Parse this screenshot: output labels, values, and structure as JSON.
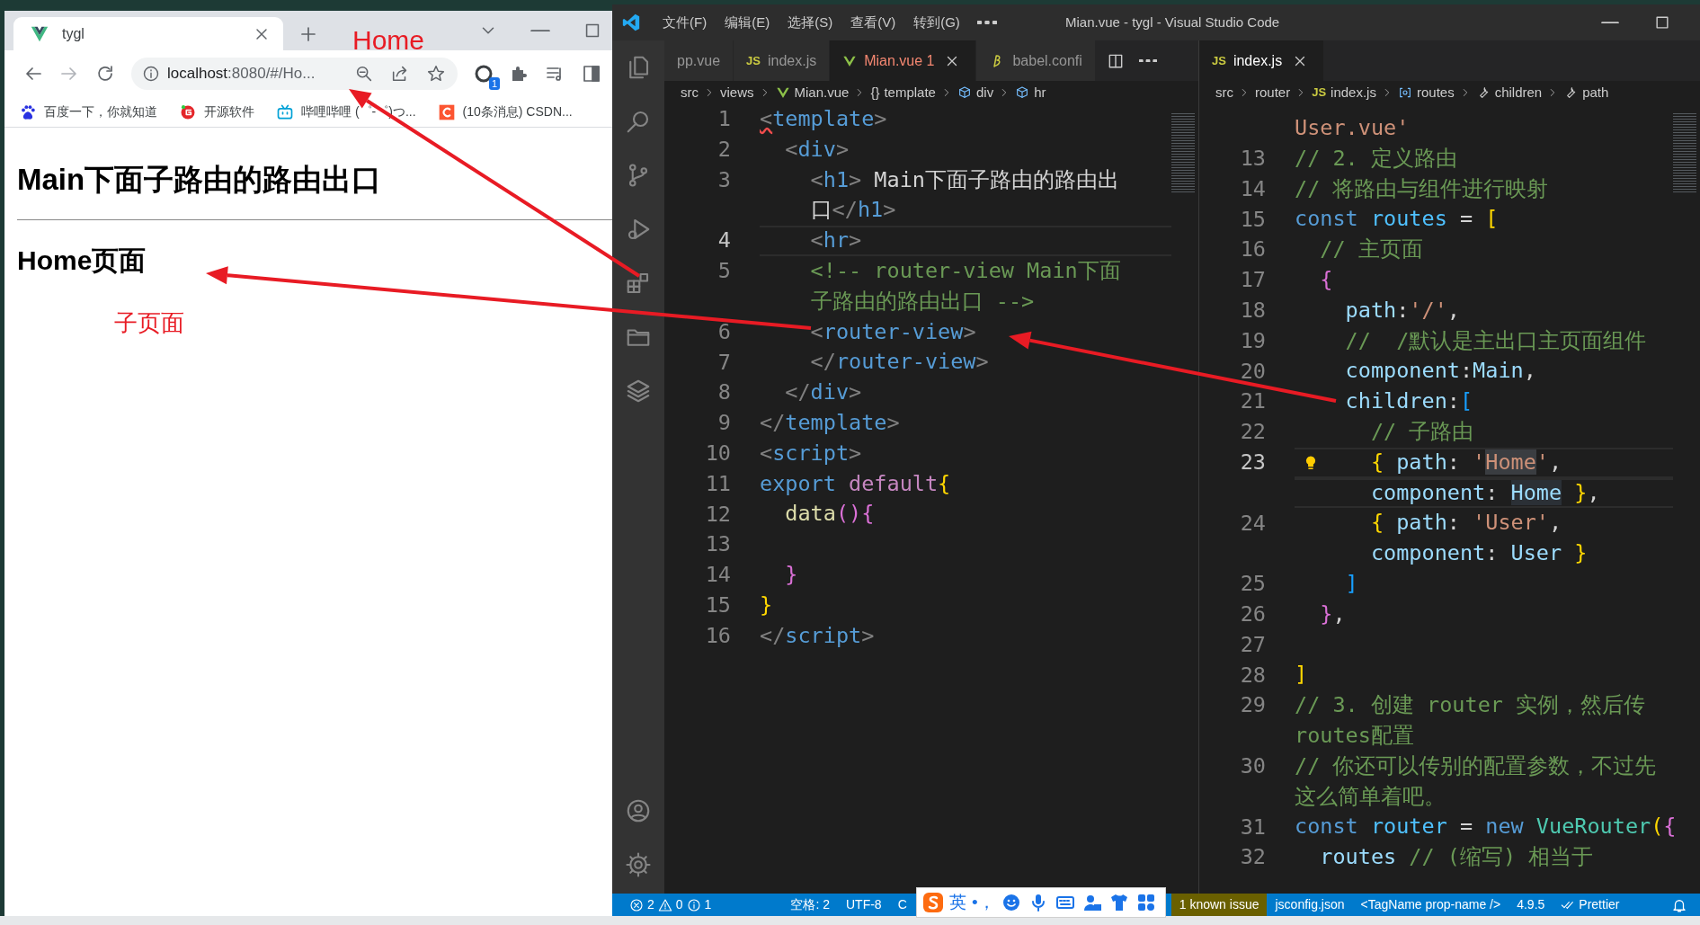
{
  "browser": {
    "tab": {
      "title": "tygl"
    },
    "address": {
      "host": "localhost",
      "path": ":8080/#/Ho..."
    },
    "extension_badge": "1",
    "bookmarks": [
      {
        "label": "百度一下，你就知道",
        "kind": "paw"
      },
      {
        "label": "开源软件",
        "kind": "gitee"
      },
      {
        "label": "哔哩哔哩 (゜-゜)つ...",
        "kind": "tv"
      },
      {
        "label": "(10条消息) CSDN...",
        "kind": "csdn"
      }
    ],
    "page": {
      "heading": "Main下面子路由的路由出口",
      "subheading": "Home页面"
    }
  },
  "annotations": [
    {
      "text": "Home",
      "kind": "tab"
    },
    {
      "text": "子页面",
      "kind": "page"
    }
  ],
  "editor": {
    "title": "Mian.vue - tygl - Visual Studio Code",
    "menus": [
      "文件(F)",
      "编辑(E)",
      "选择(S)",
      "查看(V)",
      "转到(G)"
    ],
    "left_pane": {
      "tabs": [
        {
          "label": "pp.vue",
          "kind": "none",
          "selected": false,
          "has_errors": false
        },
        {
          "label": "index.js",
          "kind": "js",
          "badge": "JS",
          "selected": false,
          "has_errors": false
        },
        {
          "label": "Mian.vue 1",
          "kind": "vue",
          "selected": true,
          "has_errors": true
        },
        {
          "label": "babel.confi",
          "kind": "babel",
          "selected": false,
          "has_errors": false
        }
      ],
      "breadcrumbs": [
        {
          "label": "src",
          "kind": "folder"
        },
        {
          "label": "views",
          "kind": "folder"
        },
        {
          "label": "Mian.vue",
          "kind": "vue"
        },
        {
          "label": "template",
          "kind": "braces",
          "badge": "{}"
        },
        {
          "label": "div",
          "kind": "element"
        },
        {
          "label": "hr",
          "kind": "element"
        }
      ],
      "lines": [
        {
          "number": "1",
          "current": false,
          "rows": [
            {
              "tokens": [
                {
                  "text": "<",
                  "kind": "punct_error"
                },
                {
                  "text": "template",
                  "kind": "tag"
                },
                {
                  "text": ">",
                  "kind": "punct"
                }
              ]
            }
          ]
        },
        {
          "number": "2",
          "current": false,
          "rows": [
            {
              "tokens": [
                {
                  "text": "  <",
                  "kind": "punct"
                },
                {
                  "text": "div",
                  "kind": "tag"
                },
                {
                  "text": ">",
                  "kind": "punct"
                }
              ]
            }
          ]
        },
        {
          "number": "3",
          "current": false,
          "rows": [
            {
              "tokens": [
                {
                  "text": "    <",
                  "kind": "punct"
                },
                {
                  "text": "h1",
                  "kind": "tag"
                },
                {
                  "text": ">",
                  "kind": "punct"
                },
                {
                  "text": " Main下面子路由的路由出",
                  "kind": "text"
                }
              ]
            },
            {
              "tokens": [
                {
                  "text": "    口",
                  "kind": "text"
                },
                {
                  "text": "</",
                  "kind": "punct"
                },
                {
                  "text": "h1",
                  "kind": "tag"
                },
                {
                  "text": ">",
                  "kind": "punct"
                }
              ]
            }
          ]
        },
        {
          "number": "4",
          "current": true,
          "rows": [
            {
              "tokens": [
                {
                  "text": "    <",
                  "kind": "punct"
                },
                {
                  "text": "hr",
                  "kind": "tag"
                },
                {
                  "text": ">",
                  "kind": "punct"
                }
              ]
            }
          ]
        },
        {
          "number": "5",
          "current": false,
          "rows": [
            {
              "tokens": [
                {
                  "text": "    <!-- router-view Main下面",
                  "kind": "comment"
                }
              ]
            },
            {
              "tokens": [
                {
                  "text": "    子路由的路由出口 -->",
                  "kind": "comment"
                }
              ]
            }
          ]
        },
        {
          "number": "6",
          "current": false,
          "rows": [
            {
              "tokens": [
                {
                  "text": "    <",
                  "kind": "punct"
                },
                {
                  "text": "router-view",
                  "kind": "tag"
                },
                {
                  "text": ">",
                  "kind": "punct"
                }
              ]
            }
          ]
        },
        {
          "number": "7",
          "current": false,
          "rows": [
            {
              "tokens": [
                {
                  "text": "    </",
                  "kind": "punct"
                },
                {
                  "text": "router-view",
                  "kind": "tag"
                },
                {
                  "text": ">",
                  "kind": "punct"
                }
              ]
            }
          ]
        },
        {
          "number": "8",
          "current": false,
          "rows": [
            {
              "tokens": [
                {
                  "text": "  </",
                  "kind": "punct"
                },
                {
                  "text": "div",
                  "kind": "tag"
                },
                {
                  "text": ">",
                  "kind": "punct"
                }
              ]
            }
          ]
        },
        {
          "number": "9",
          "current": false,
          "rows": [
            {
              "tokens": [
                {
                  "text": "</",
                  "kind": "punct"
                },
                {
                  "text": "template",
                  "kind": "tag"
                },
                {
                  "text": ">",
                  "kind": "punct"
                }
              ]
            }
          ]
        },
        {
          "number": "10",
          "current": false,
          "rows": [
            {
              "tokens": [
                {
                  "text": "<",
                  "kind": "punct"
                },
                {
                  "text": "script",
                  "kind": "tag"
                },
                {
                  "text": ">",
                  "kind": "punct"
                }
              ]
            }
          ]
        },
        {
          "number": "11",
          "current": false,
          "rows": [
            {
              "tokens": [
                {
                  "text": "export",
                  "kind": "keyword"
                },
                {
                  "text": " default",
                  "kind": "control"
                },
                {
                  "text": "{",
                  "kind": "bracket1"
                }
              ]
            }
          ]
        },
        {
          "number": "12",
          "current": false,
          "rows": [
            {
              "tokens": [
                {
                  "text": "  data",
                  "kind": "func"
                },
                {
                  "text": "(){",
                  "kind": "bracket2"
                }
              ]
            }
          ]
        },
        {
          "number": "13",
          "current": false
        },
        {
          "number": "14",
          "current": false,
          "rows": [
            {
              "tokens": [
                {
                  "text": "  }",
                  "kind": "bracket2"
                }
              ]
            }
          ]
        },
        {
          "number": "15",
          "current": false,
          "rows": [
            {
              "tokens": [
                {
                  "text": "}",
                  "kind": "bracket1"
                }
              ]
            }
          ]
        },
        {
          "number": "16",
          "current": false,
          "rows": [
            {
              "tokens": [
                {
                  "text": "</",
                  "kind": "punct"
                },
                {
                  "text": "script",
                  "kind": "tag"
                },
                {
                  "text": ">",
                  "kind": "punct"
                }
              ]
            }
          ]
        }
      ]
    },
    "right_pane": {
      "tabs": [
        {
          "label": "index.js",
          "kind": "js",
          "badge": "JS",
          "selected": true,
          "has_errors": false
        }
      ],
      "breadcrumbs": [
        {
          "label": "src",
          "kind": "folder"
        },
        {
          "label": "router",
          "kind": "folder"
        },
        {
          "label": "index.js",
          "kind": "js",
          "badge": "JS"
        },
        {
          "label": "routes",
          "kind": "array"
        },
        {
          "label": "children",
          "kind": "property"
        },
        {
          "label": "path",
          "kind": "property"
        }
      ],
      "lines": [
        {
          "current": false,
          "rows": [
            {
              "tokens": [
                {
                  "text": "User.vue'",
                  "kind": "string"
                }
              ]
            }
          ]
        },
        {
          "number": "13",
          "current": false,
          "rows": [
            {
              "tokens": [
                {
                  "text": "// 2. 定义路由",
                  "kind": "comment"
                }
              ]
            }
          ]
        },
        {
          "number": "14",
          "current": false,
          "rows": [
            {
              "tokens": [
                {
                  "text": "// 将路由与组件进行映射",
                  "kind": "comment"
                }
              ]
            }
          ]
        },
        {
          "number": "15",
          "current": false,
          "rows": [
            {
              "tokens": [
                {
                  "text": "const",
                  "kind": "keyword"
                },
                {
                  "text": " routes",
                  "kind": "const"
                },
                {
                  "text": " = ",
                  "kind": "plain"
                },
                {
                  "text": "[",
                  "kind": "bracket1"
                }
              ]
            }
          ]
        },
        {
          "number": "16",
          "current": false,
          "rows": [
            {
              "tokens": [
                {
                  "text": "  // 主页面",
                  "kind": "comment"
                }
              ]
            }
          ]
        },
        {
          "number": "17",
          "current": false,
          "rows": [
            {
              "tokens": [
                {
                  "text": "  {",
                  "kind": "bracket2"
                }
              ]
            }
          ]
        },
        {
          "number": "18",
          "current": false,
          "rows": [
            {
              "tokens": [
                {
                  "text": "    path",
                  "kind": "prop"
                },
                {
                  "text": ":",
                  "kind": "plain"
                },
                {
                  "text": "'/'",
                  "kind": "string"
                },
                {
                  "text": ",",
                  "kind": "plain"
                }
              ]
            }
          ]
        },
        {
          "number": "19",
          "current": false,
          "rows": [
            {
              "tokens": [
                {
                  "text": "    //  /默认是主出口主页面组件",
                  "kind": "comment"
                }
              ]
            }
          ]
        },
        {
          "number": "20",
          "current": false,
          "rows": [
            {
              "tokens": [
                {
                  "text": "    component",
                  "kind": "prop"
                },
                {
                  "text": ":",
                  "kind": "plain"
                },
                {
                  "text": "Main",
                  "kind": "var"
                },
                {
                  "text": ",",
                  "kind": "plain"
                }
              ]
            }
          ]
        },
        {
          "number": "21",
          "current": false,
          "rows": [
            {
              "tokens": [
                {
                  "text": "    children",
                  "kind": "prop"
                },
                {
                  "text": ":",
                  "kind": "plain"
                },
                {
                  "text": "[",
                  "kind": "bracket3"
                }
              ]
            }
          ]
        },
        {
          "number": "22",
          "current": false,
          "rows": [
            {
              "tokens": [
                {
                  "text": "      // 子路由",
                  "kind": "comment"
                }
              ]
            }
          ]
        },
        {
          "number": "23",
          "current": true,
          "rows": [
            {
              "tokens": [
                {
                  "text": "      {",
                  "kind": "bracket1"
                },
                {
                  "text": " path",
                  "kind": "prop"
                },
                {
                  "text": ": ",
                  "kind": "plain"
                },
                {
                  "text": "'",
                  "kind": "string"
                },
                {
                  "text": "Home",
                  "kind": "string_hl"
                },
                {
                  "text": "'",
                  "kind": "string"
                },
                {
                  "text": ",",
                  "kind": "plain"
                }
              ]
            },
            {
              "tokens": [
                {
                  "text": "      component",
                  "kind": "prop"
                },
                {
                  "text": ": ",
                  "kind": "plain"
                },
                {
                  "text": "Home",
                  "kind": "var_hl"
                },
                {
                  "text": " }",
                  "kind": "bracket1"
                },
                {
                  "text": ",",
                  "kind": "plain"
                }
              ]
            }
          ]
        },
        {
          "number": "24",
          "current": false,
          "rows": [
            {
              "tokens": [
                {
                  "text": "      {",
                  "kind": "bracket1"
                },
                {
                  "text": " path",
                  "kind": "prop"
                },
                {
                  "text": ": ",
                  "kind": "plain"
                },
                {
                  "text": "'User'",
                  "kind": "string"
                },
                {
                  "text": ",",
                  "kind": "plain"
                }
              ]
            },
            {
              "tokens": [
                {
                  "text": "      component",
                  "kind": "prop"
                },
                {
                  "text": ": ",
                  "kind": "plain"
                },
                {
                  "text": "User",
                  "kind": "var"
                },
                {
                  "text": " }",
                  "kind": "bracket1"
                }
              ]
            }
          ]
        },
        {
          "number": "25",
          "current": false,
          "rows": [
            {
              "tokens": [
                {
                  "text": "    ]",
                  "kind": "bracket3"
                }
              ]
            }
          ]
        },
        {
          "number": "26",
          "current": false,
          "rows": [
            {
              "tokens": [
                {
                  "text": "  }",
                  "kind": "bracket2"
                },
                {
                  "text": ",",
                  "kind": "plain"
                }
              ]
            }
          ]
        },
        {
          "number": "27",
          "current": false
        },
        {
          "number": "28",
          "current": false,
          "rows": [
            {
              "tokens": [
                {
                  "text": "]",
                  "kind": "bracket1"
                }
              ]
            }
          ]
        },
        {
          "number": "29",
          "current": false,
          "rows": [
            {
              "tokens": [
                {
                  "text": "// 3. 创建 router 实例，然后传",
                  "kind": "comment"
                }
              ]
            },
            {
              "tokens": [
                {
                  "text": "routes配置",
                  "kind": "comment"
                }
              ]
            }
          ]
        },
        {
          "number": "30",
          "current": false,
          "rows": [
            {
              "tokens": [
                {
                  "text": "// 你还可以传别的配置参数，不过先",
                  "kind": "comment"
                }
              ]
            },
            {
              "tokens": [
                {
                  "text": "这么简单着吧。",
                  "kind": "comment"
                }
              ]
            }
          ]
        },
        {
          "number": "31",
          "current": false,
          "rows": [
            {
              "tokens": [
                {
                  "text": "const",
                  "kind": "keyword"
                },
                {
                  "text": " router",
                  "kind": "const"
                },
                {
                  "text": " = ",
                  "kind": "plain"
                },
                {
                  "text": "new",
                  "kind": "keyword"
                },
                {
                  "text": " VueRouter",
                  "kind": "class"
                },
                {
                  "text": "(",
                  "kind": "bracket1"
                },
                {
                  "text": "{",
                  "kind": "bracket2"
                }
              ]
            }
          ]
        },
        {
          "number": "32",
          "current": false,
          "rows": [
            {
              "tokens": [
                {
                  "text": "  routes",
                  "kind": "prop"
                },
                {
                  "text": " // (缩写) 相当于",
                  "kind": "comment"
                }
              ]
            }
          ]
        }
      ]
    },
    "status_bar": {
      "problems": {
        "errors": "2",
        "warnings": "0",
        "infos": "1"
      },
      "items": [
        {
          "text": "空格: 2",
          "kind": "plain"
        },
        {
          "text": "UTF-8",
          "kind": "plain"
        },
        {
          "text": "C",
          "kind": "plain"
        },
        {
          "text": "1 known issue",
          "kind": "issue"
        },
        {
          "text": "jsconfig.json",
          "kind": "plain"
        },
        {
          "text": "<TagName prop-name />",
          "kind": "plain"
        },
        {
          "text": "4.9.5",
          "kind": "plain"
        },
        {
          "text": "Prettier",
          "kind": "prettier"
        }
      ]
    },
    "ime": {
      "mode": "英",
      "punctuation": "•，"
    }
  }
}
